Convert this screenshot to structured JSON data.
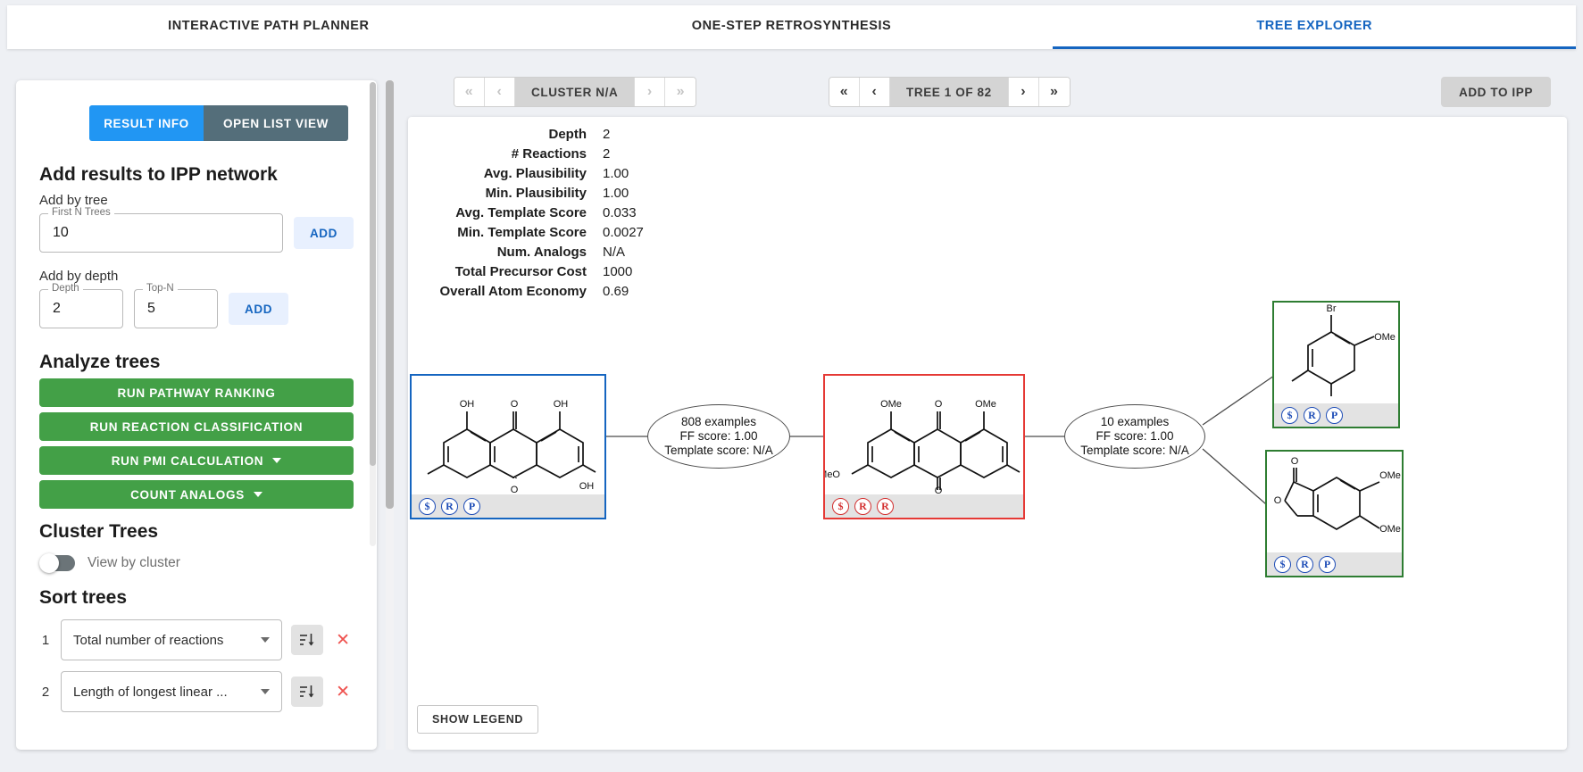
{
  "tabs": [
    {
      "label": "INTERACTIVE PATH PLANNER",
      "active": false
    },
    {
      "label": "ONE-STEP RETROSYNTHESIS",
      "active": false
    },
    {
      "label": "TREE EXPLORER",
      "active": true
    }
  ],
  "sidebar": {
    "seg_primary": "RESULT INFO",
    "seg_secondary": "OPEN LIST VIEW",
    "add_results_title": "Add results to IPP network",
    "add_by_tree_label": "Add by tree",
    "first_n_trees_legend": "First N Trees",
    "first_n_trees_value": "10",
    "add_tree_button": "ADD",
    "add_by_depth_label": "Add by depth",
    "depth_legend": "Depth",
    "depth_value": "2",
    "topn_legend": "Top-N",
    "topn_value": "5",
    "add_depth_button": "ADD",
    "analyze_title": "Analyze trees",
    "analyze_buttons": [
      {
        "label": "RUN PATHWAY RANKING",
        "caret": false
      },
      {
        "label": "RUN REACTION CLASSIFICATION",
        "caret": false
      },
      {
        "label": "RUN PMI CALCULATION",
        "caret": true
      },
      {
        "label": "COUNT ANALOGS",
        "caret": true
      }
    ],
    "cluster_title": "Cluster Trees",
    "view_by_cluster_label": "View by cluster",
    "view_by_cluster_on": false,
    "sort_title": "Sort trees",
    "sort_rows": [
      {
        "num": "1",
        "value": "Total number of reactions"
      },
      {
        "num": "2",
        "value": "Length of longest linear ..."
      }
    ]
  },
  "topnav": {
    "cluster_label": "CLUSTER N/A",
    "tree_label": "TREE 1 OF 82",
    "first_icon": "«",
    "prev_icon": "‹",
    "next_icon": "›",
    "last_icon": "»",
    "add_to_ipp": "ADD TO IPP"
  },
  "info_table": [
    {
      "key": "Depth",
      "value": "2"
    },
    {
      "key": "# Reactions",
      "value": "2"
    },
    {
      "key": "Avg. Plausibility",
      "value": "1.00"
    },
    {
      "key": "Min. Plausibility",
      "value": "1.00"
    },
    {
      "key": "Avg. Template Score",
      "value": "0.033"
    },
    {
      "key": "Min. Template Score",
      "value": "0.0027"
    },
    {
      "key": "Num. Analogs",
      "value": "N/A"
    },
    {
      "key": "Total Precursor Cost",
      "value": "1000"
    },
    {
      "key": "Overall Atom Economy",
      "value": "0.69"
    }
  ],
  "show_legend_button": "SHOW LEGEND",
  "tree": {
    "nodes": [
      {
        "id": "target",
        "border_color": "#1565c0",
        "badges": [
          {
            "t": "$",
            "c": "blue"
          },
          {
            "t": "R",
            "c": "blue"
          },
          {
            "t": "P",
            "c": "blue"
          }
        ],
        "labels": [
          "OH",
          "O",
          "OH",
          "OH",
          "O"
        ],
        "name": "target-molecule"
      },
      {
        "id": "intermediate",
        "border_color": "#e53935",
        "badges": [
          {
            "t": "$",
            "c": "red"
          },
          {
            "t": "R",
            "c": "red"
          },
          {
            "t": "R",
            "c": "red"
          }
        ],
        "labels": [
          "OMe",
          "O",
          "OMe",
          "MeO",
          "O"
        ],
        "name": "intermediate-molecule"
      },
      {
        "id": "leaf-top",
        "border_color": "#2e7d32",
        "badges": [
          {
            "t": "$",
            "c": "blue"
          },
          {
            "t": "R",
            "c": "blue"
          },
          {
            "t": "P",
            "c": "blue"
          }
        ],
        "labels": [
          "Br",
          "OMe"
        ],
        "name": "precursor-molecule-top"
      },
      {
        "id": "leaf-bottom",
        "border_color": "#2e7d32",
        "badges": [
          {
            "t": "$",
            "c": "blue"
          },
          {
            "t": "R",
            "c": "blue"
          },
          {
            "t": "P",
            "c": "blue"
          }
        ],
        "labels": [
          "OMe",
          "O",
          "O",
          "OMe"
        ],
        "name": "precursor-molecule-bottom"
      }
    ],
    "reactions": [
      {
        "examples": "808 examples",
        "ff": "FF score: 1.00",
        "template": "Template score: N/A"
      },
      {
        "examples": "10 examples",
        "ff": "FF score: 1.00",
        "template": "Template score: N/A"
      }
    ]
  }
}
